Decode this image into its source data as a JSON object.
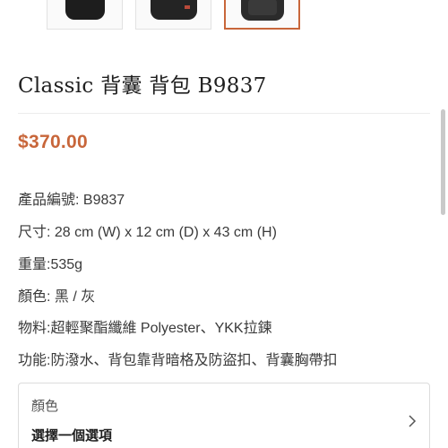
{
  "gallery": {
    "thumbnails": [
      "product-photo-1",
      "product-photo-2",
      "product-photo-3"
    ],
    "active_index": 2,
    "accent_color": "#c8663a"
  },
  "product": {
    "title": "Classic 背囊 背包 B9837",
    "price": "$370.00",
    "price_color": "#c8663a",
    "specs": [
      "產品編號: B9837",
      "尺寸: 28 cm (W) x 12 cm (D) x 43 cm (H)",
      "重量:535g",
      "顏色: 黑 / 灰",
      "物料:超輕聚酯纖維 Polyester、YKK拉鍊",
      "功能:防潑水、背包靠背暗格及防盜扣、背囊胸帶扣"
    ]
  },
  "variant_select": {
    "label": "顏色",
    "value": "選擇一個選項",
    "icon": "chevron-right-icon"
  }
}
